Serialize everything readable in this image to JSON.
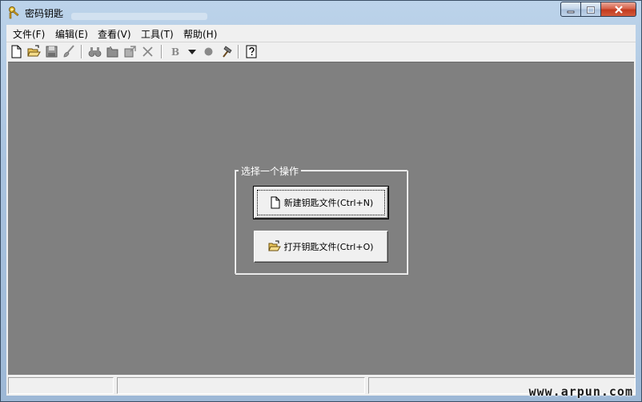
{
  "window": {
    "title": "密码钥匙",
    "icon": "key-icon",
    "controls": [
      "minimize-icon",
      "maximize-icon",
      "close-icon"
    ]
  },
  "menu": {
    "items": [
      {
        "label": "文件(F)"
      },
      {
        "label": "编辑(E)"
      },
      {
        "label": "查看(V)"
      },
      {
        "label": "工具(T)"
      },
      {
        "label": "帮助(H)"
      }
    ]
  },
  "toolbar": {
    "icons": [
      "new-file-icon",
      "open-folder-icon",
      "save-icon",
      "brush-icon",
      "binoculars-icon",
      "folder-icon",
      "properties-icon",
      "delete-icon",
      "bold-icon",
      "dropdown-arrow-icon",
      "dot-icon",
      "hammer-icon",
      "help-icon"
    ],
    "bold_label": "B"
  },
  "dialog": {
    "group_title": "选择一个操作",
    "new_button": "新建钥匙文件(Ctrl+N)",
    "open_button": "打开钥匙文件(Ctrl+O)"
  },
  "watermark": "www.arpun.com",
  "colors": {
    "workspace": "#808080",
    "frame": "#a9c3df",
    "close_button": "#c9482c"
  }
}
